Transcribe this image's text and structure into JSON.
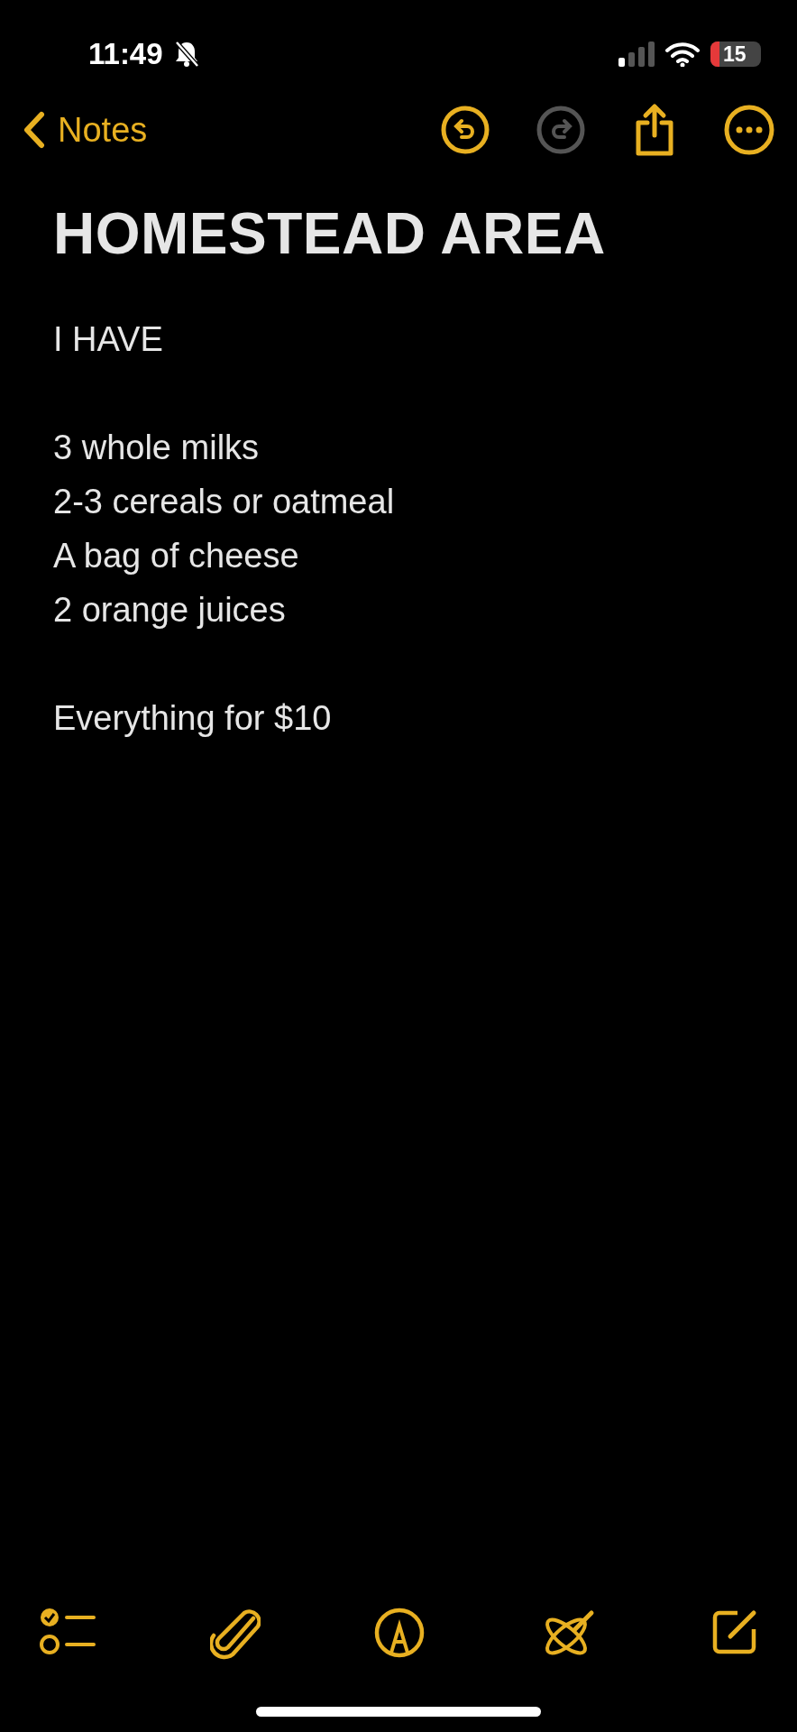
{
  "status_bar": {
    "time": "11:49",
    "silent": true,
    "battery": "15",
    "battery_low": true
  },
  "nav": {
    "back_label": "Notes",
    "undo_enabled": true,
    "redo_enabled": false
  },
  "note": {
    "title": "HOMESTEAD AREA",
    "paragraphs": [
      [
        "I HAVE"
      ],
      [
        "3 whole milks",
        "2-3 cereals or oatmeal",
        "A bag of cheese",
        "2 orange juices"
      ],
      [
        "Everything for $10"
      ]
    ]
  },
  "toolbar": [
    {
      "kind": "checklist"
    },
    {
      "kind": "attach"
    },
    {
      "kind": "markup"
    },
    {
      "kind": "writing"
    },
    {
      "kind": "compose"
    }
  ]
}
